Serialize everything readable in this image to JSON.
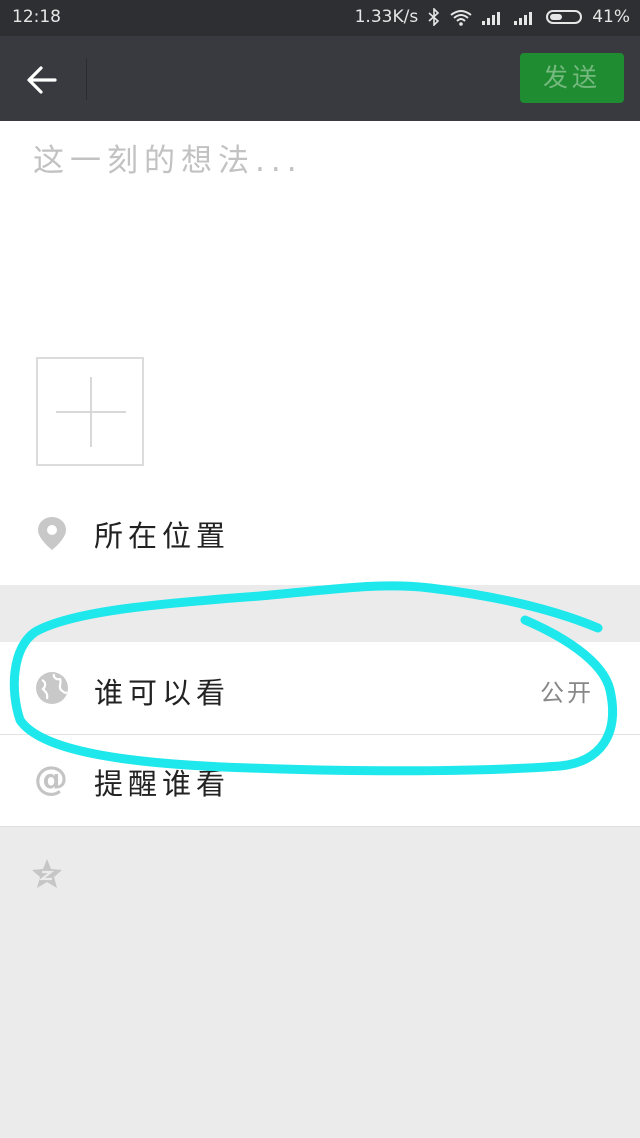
{
  "status_bar": {
    "time": "12:18",
    "network_speed": "1.33K/s",
    "battery": "41%",
    "icons": [
      "bluetooth-icon",
      "wifi-icon",
      "signal-icon",
      "signal-icon",
      "battery-icon"
    ]
  },
  "toolbar": {
    "back_icon": "back-arrow-icon",
    "send_label": "发送"
  },
  "compose": {
    "placeholder": "这一刻的想法..."
  },
  "location": {
    "label": "所在位置",
    "icon": "location-pin-icon"
  },
  "visibility": {
    "label": "谁可以看",
    "value": "公开",
    "icon": "globe-icon"
  },
  "remind": {
    "label": "提醒谁看",
    "icon": "at-icon"
  },
  "extra": {
    "icon": "qzone-star-icon"
  },
  "colors": {
    "status_bg": "#2e2f33",
    "toolbar_bg": "#393a3f",
    "send_bg": "#1f8c32",
    "send_text": "#76b97f",
    "annotation": "#1ee8ec",
    "page_bg": "#ebebeb"
  }
}
